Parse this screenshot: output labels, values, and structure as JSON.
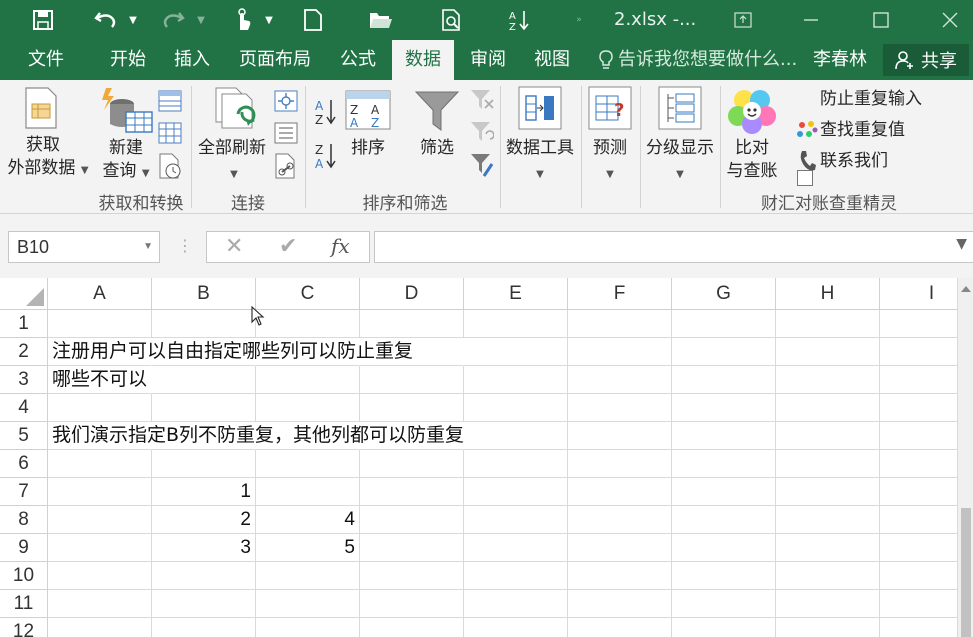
{
  "titlebar": {
    "file_title": "2.xlsx -..."
  },
  "tabs": [
    {
      "label": "文件"
    },
    {
      "label": "开始"
    },
    {
      "label": "插入"
    },
    {
      "label": "页面布局"
    },
    {
      "label": "公式"
    },
    {
      "label": "数据"
    },
    {
      "label": "审阅"
    },
    {
      "label": "视图"
    }
  ],
  "tellme": "告诉我您想要做什么...",
  "user": "李春林",
  "share": "共享",
  "ribbon": {
    "get_external_1": "获取",
    "get_external_2": "外部数据",
    "new_query_1": "新建",
    "new_query_2": "查询",
    "refresh_all": "全部刷新",
    "sort": "排序",
    "filter": "筛选",
    "data_tools": "数据工具",
    "forecast": "预测",
    "outline": "分级显示",
    "compare_1": "比对",
    "compare_2": "与查账",
    "prevent_dup": "防止重复输入",
    "find_dup": "查找重复值",
    "contact": "联系我们",
    "groups": {
      "get_transform": "获取和转换",
      "connections": "连接",
      "sort_filter": "排序和筛选",
      "addin": "财汇对账查重精灵"
    }
  },
  "formula_bar": {
    "name_box": "B10",
    "fx": "fx",
    "content": ""
  },
  "columns": [
    "A",
    "B",
    "C",
    "D",
    "E",
    "F",
    "G",
    "H",
    "I"
  ],
  "rows": [
    "1",
    "2",
    "3",
    "4",
    "5",
    "6",
    "7",
    "8",
    "9",
    "10",
    "11",
    "12"
  ],
  "cells": {
    "A2": "注册用户可以自由指定哪些列可以防止重复",
    "A3": "哪些不可以",
    "A5": "我们演示指定B列不防重复，其他列都可以防重复",
    "B7": "1",
    "B8": "2",
    "C8": "4",
    "B9": "3",
    "C9": "5"
  },
  "colors": {
    "excel_green": "#217346",
    "ribbon_bg": "#f3f3f3"
  }
}
